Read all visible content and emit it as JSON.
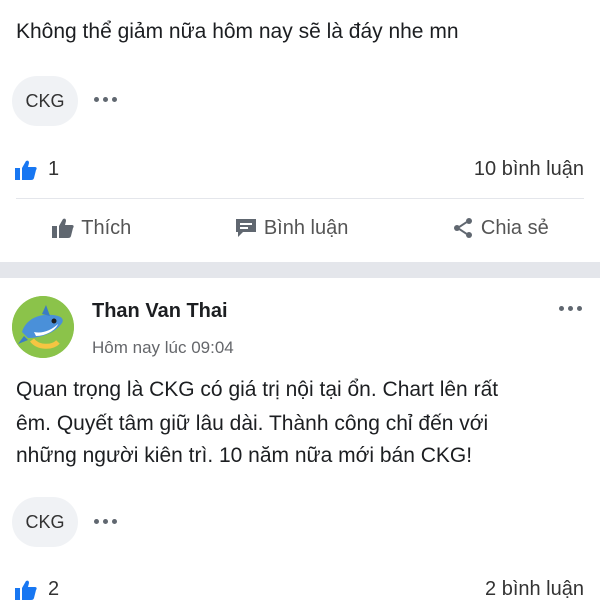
{
  "post1": {
    "text": "Không thể giảm nữa hôm nay sẽ là đáy nhe mn",
    "tag": "CKG",
    "like_count": "1",
    "comments": "10 bình luận"
  },
  "actions": {
    "like": "Thích",
    "comment": "Bình luận",
    "share": "Chia sẻ"
  },
  "post2": {
    "author": "Than Van Thai",
    "time": "Hôm nay lúc 09:04",
    "text_line1": "Quan trọng là CKG có giá trị nội tại ổn. Chart lên rất",
    "text_line2": "êm. Quyết tâm giữ lâu dài. Thành công chỉ đến với",
    "text_line3": "những người kiên trì. 10 năm nữa mới bán CKG!",
    "tag": "CKG",
    "like_count": "2",
    "comments": "2 bình luận"
  },
  "colors": {
    "like_blue": "#1877f2",
    "icon_gray": "#606770",
    "avatar_green": "#8bc34a"
  }
}
